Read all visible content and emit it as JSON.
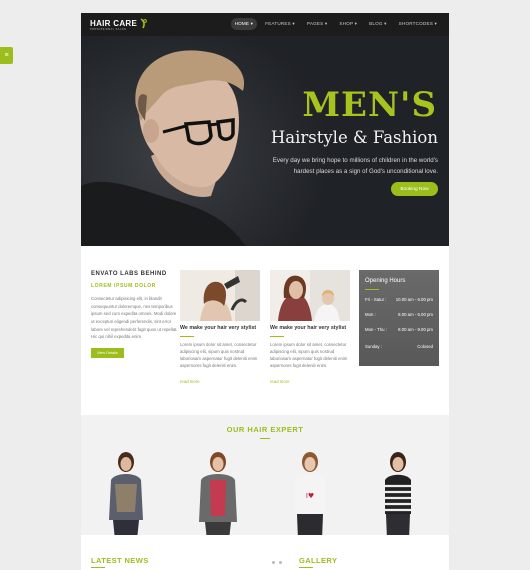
{
  "side_tab": {
    "label": "≡"
  },
  "header": {
    "logo_text": "HAIR CARE",
    "logo_tagline": "PROFESSIONAL SALON",
    "nav": [
      "HOME ▾",
      "FEATURES ▾",
      "PAGES ▾",
      "SHOP ▾",
      "BLOG ▾",
      "SHORTCODES ▾"
    ],
    "active_nav": 0
  },
  "hero": {
    "title": "MEN'S",
    "subtitle": "Hairstyle & Fashion",
    "text": "Every day we bring hope to millions of children in the world's hardest places as a sign of God's unconditional love.",
    "button": "Booking Now"
  },
  "about": {
    "heading": "ENVATO LABS BEHIND",
    "subheading": "LOREM IPSUM DOLOR",
    "text": "Consectetur adipisicing elit, in blandit consequuntur doloremque, nes temporibus ipsum sed cum expedita omnes. Modi dolore ut excepturi eligendi perferendis, sint error labore vel reprehenderit fugit quos ut repellat. Hic qui nihil expedita enim.",
    "button": "View Details"
  },
  "cards": [
    {
      "title": "We make your hair very stylist",
      "text": "Lorem ipsum dolor sit amet, consectetur adipiscing elit, sipum quis nostrud laboriosam aspernatur fugit deleniti enim aspernores fugit deleniti enim.",
      "more": "read more"
    },
    {
      "title": "We make your hair very stylist",
      "text": "Lorem ipsum dolor sit amet, consectetur adipiscing elit, sipum quis nostrud laboriosam aspernatur fugit deleniti enim aspernores fugit deleniti enim.",
      "more": "read more"
    }
  ],
  "hours": {
    "title": "Opening Hours",
    "rows": [
      {
        "day": "Fri - Satur :",
        "time": "10.00 am - 6.00 pm"
      },
      {
        "day": "Mon :",
        "time": "8.00 am - 6.00 pm"
      },
      {
        "day": "Mon - Thu :",
        "time": "8.00 am - 9.00 pm"
      },
      {
        "day": "Sunday :",
        "time": "Colosed"
      }
    ]
  },
  "expert": {
    "heading": "OUR HAIR EXPERT"
  },
  "footer": {
    "latest_news": "LATEST NEWS",
    "gallery": "GALLERY"
  },
  "colors": {
    "accent": "#9cbe1d",
    "topbar": "#1c1c1c",
    "hero_bg": "#2c2f34"
  }
}
